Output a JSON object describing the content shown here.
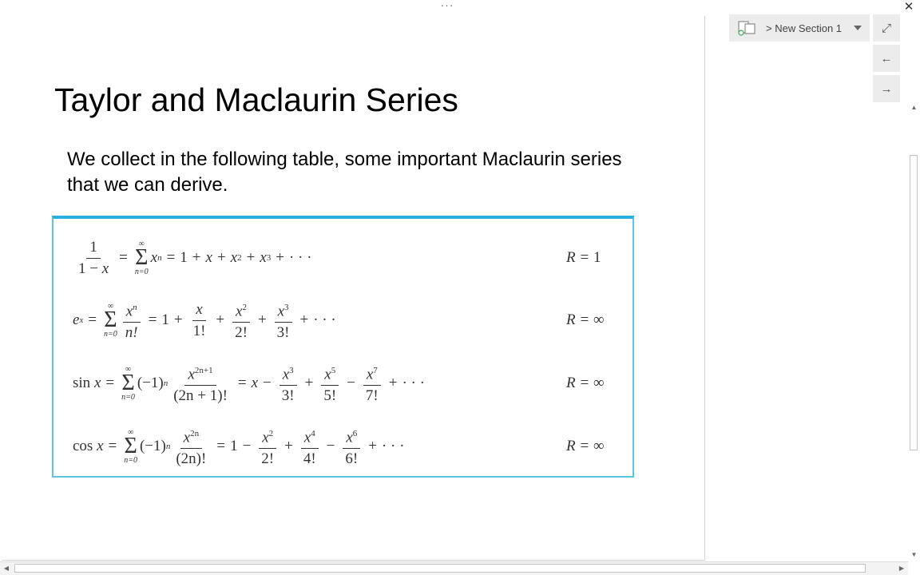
{
  "window": {
    "menu_dots": "···",
    "close_glyph": "✕"
  },
  "slide": {
    "title": "Taylor and Maclaurin Series",
    "body": "We collect in the following table, some important Maclaurin series that we can derive."
  },
  "math": {
    "one": "1",
    "one_minus_x_a": "1 −",
    "x": "x",
    "eq": "=",
    "plus": "+",
    "minus": "−",
    "dots": "· · ·",
    "inf": "∞",
    "n_eq_0": "n=0",
    "sigma": "Σ",
    "n": "n",
    "two": "2",
    "three": "3",
    "five": "5",
    "seven": "7",
    "four": "4",
    "six": "6",
    "n_fact": "n!",
    "f1": "1!",
    "f2": "2!",
    "f3": "3!",
    "f4": "4!",
    "f5": "5!",
    "f6": "6!",
    "f7": "7!",
    "e": "e",
    "sin": "sin",
    "cos": "cos",
    "neg1": "(−1)",
    "exp_2n1": "2n+1",
    "den_2n1": "(2n + 1)!",
    "exp_2n": "2n",
    "den_2n": "(2n)!",
    "R_eq": "R =",
    "R_one": "1",
    "R_inf": "∞"
  },
  "sidebar": {
    "section_label": "> New Section 1",
    "expand_glyph": "⤢",
    "back_glyph": "←",
    "forward_glyph": "→"
  },
  "scroll": {
    "up": "▲",
    "down": "▼",
    "left": "◀",
    "right": "▶"
  },
  "colors": {
    "box_border": "#2ab0dc",
    "panel_button_bg": "#ececec"
  }
}
